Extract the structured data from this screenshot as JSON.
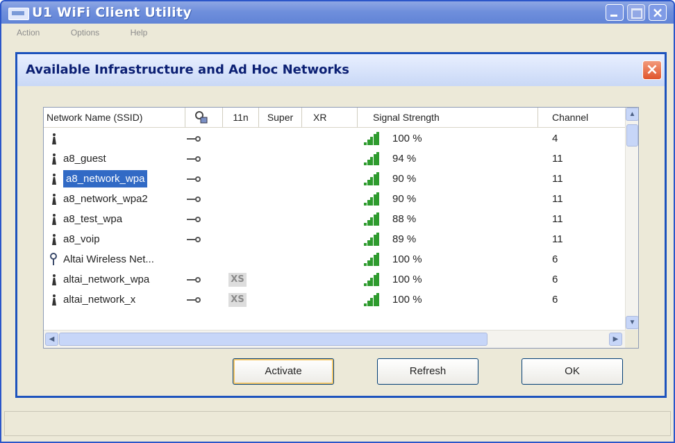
{
  "window": {
    "title": "U1 WiFi Client Utility"
  },
  "menu": [
    "Action",
    "Options",
    "Help"
  ],
  "dialog": {
    "title": "Available Infrastructure and Ad Hoc Networks"
  },
  "columns": {
    "ssid": "Network Name (SSID)",
    "n11": "11n",
    "super": "Super",
    "xr": "XR",
    "signal": "Signal Strength",
    "channel": "Channel"
  },
  "networks": [
    {
      "ssid": "",
      "icon": "access-point-icon",
      "secured": true,
      "xr": "",
      "signal": "100 %",
      "channel": "4"
    },
    {
      "ssid": "a8_guest",
      "icon": "access-point-icon",
      "secured": true,
      "xr": "",
      "signal": "94 %",
      "channel": "11"
    },
    {
      "ssid": "a8_network_wpa",
      "icon": "access-point-icon",
      "secured": true,
      "xr": "",
      "signal": "90 %",
      "channel": "11",
      "selected": true
    },
    {
      "ssid": "a8_network_wpa2",
      "icon": "access-point-icon",
      "secured": true,
      "xr": "",
      "signal": "90 %",
      "channel": "11"
    },
    {
      "ssid": "a8_test_wpa",
      "icon": "access-point-icon",
      "secured": true,
      "xr": "",
      "signal": "88 %",
      "channel": "11"
    },
    {
      "ssid": "a8_voip",
      "icon": "access-point-icon",
      "secured": true,
      "xr": "",
      "signal": "89 %",
      "channel": "11"
    },
    {
      "ssid": "Altai Wireless Net...",
      "icon": "adhoc-icon",
      "secured": false,
      "xr": "",
      "signal": "100 %",
      "channel": "6"
    },
    {
      "ssid": "altai_network_wpa",
      "icon": "access-point-icon",
      "secured": true,
      "xr": "XS",
      "signal": "100 %",
      "channel": "6"
    },
    {
      "ssid": "altai_network_x",
      "icon": "access-point-icon",
      "secured": true,
      "xr": "XS",
      "signal": "100 %",
      "channel": "6"
    }
  ],
  "buttons": {
    "activate": "Activate",
    "refresh": "Refresh",
    "ok": "OK"
  },
  "colors": {
    "titlebar": "#6f8fdc",
    "dialog_border": "#1d53bd",
    "selection": "#316ac5",
    "signal": "#2e9b2e"
  }
}
